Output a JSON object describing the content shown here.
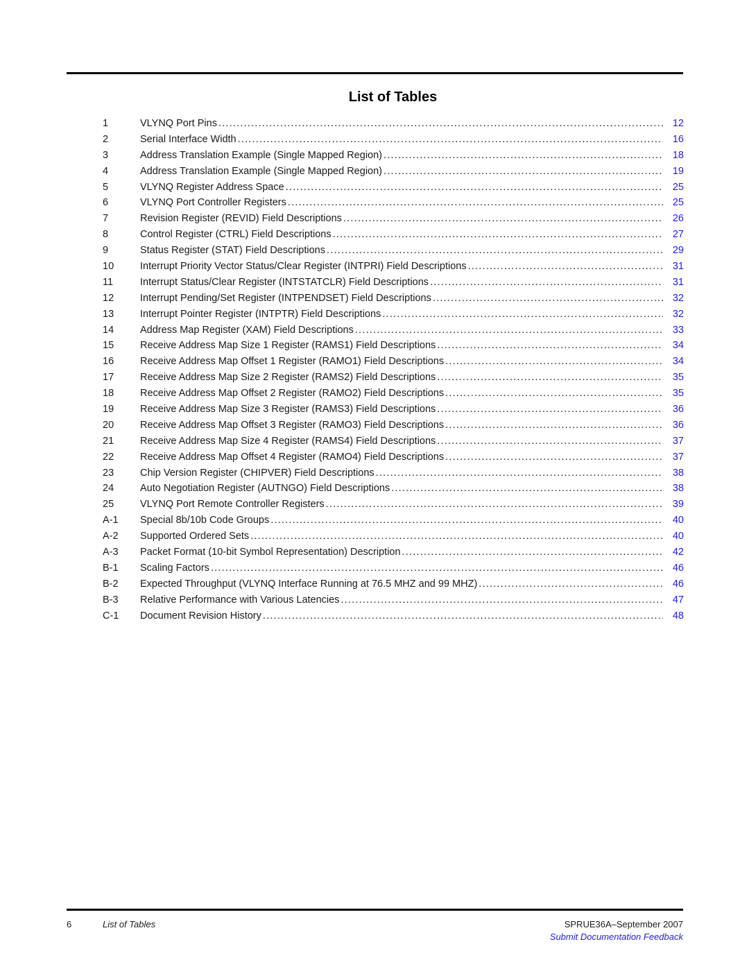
{
  "title": "List of Tables",
  "entries": [
    {
      "num": "1",
      "title": "VLYNQ Port Pins",
      "page": "12"
    },
    {
      "num": "2",
      "title": "Serial Interface Width",
      "page": "16"
    },
    {
      "num": "3",
      "title": "Address Translation Example (Single Mapped Region)",
      "page": "18"
    },
    {
      "num": "4",
      "title": "Address Translation Example (Single Mapped Region)",
      "page": "19"
    },
    {
      "num": "5",
      "title": "VLYNQ Register Address Space",
      "page": "25"
    },
    {
      "num": "6",
      "title": "VLYNQ Port Controller Registers",
      "page": "25"
    },
    {
      "num": "7",
      "title": "Revision Register (REVID) Field Descriptions",
      "page": "26"
    },
    {
      "num": "8",
      "title": "Control Register (CTRL) Field Descriptions",
      "page": "27"
    },
    {
      "num": "9",
      "title": "Status Register (STAT) Field Descriptions",
      "page": "29"
    },
    {
      "num": "10",
      "title": "Interrupt Priority Vector Status/Clear Register (INTPRI) Field Descriptions",
      "page": "31"
    },
    {
      "num": "11",
      "title": "Interrupt Status/Clear Register (INTSTATCLR) Field Descriptions",
      "page": "31"
    },
    {
      "num": "12",
      "title": "Interrupt Pending/Set Register (INTPENDSET) Field Descriptions",
      "page": "32"
    },
    {
      "num": "13",
      "title": "Interrupt Pointer Register (INTPTR) Field Descriptions",
      "page": "32"
    },
    {
      "num": "14",
      "title": "Address Map Register (XAM) Field Descriptions",
      "page": "33"
    },
    {
      "num": "15",
      "title": "Receive Address Map Size 1 Register (RAMS1) Field Descriptions",
      "page": "34"
    },
    {
      "num": "16",
      "title": "Receive Address Map Offset 1 Register (RAMO1) Field Descriptions",
      "page": "34"
    },
    {
      "num": "17",
      "title": "Receive Address Map Size 2 Register (RAMS2) Field Descriptions",
      "page": "35"
    },
    {
      "num": "18",
      "title": "Receive Address Map Offset 2 Register (RAMO2) Field Descriptions",
      "page": "35"
    },
    {
      "num": "19",
      "title": "Receive Address Map Size 3 Register (RAMS3) Field Descriptions",
      "page": "36"
    },
    {
      "num": "20",
      "title": "Receive Address Map Offset 3 Register (RAMO3) Field Descriptions",
      "page": "36"
    },
    {
      "num": "21",
      "title": "Receive Address Map Size 4 Register (RAMS4) Field Descriptions",
      "page": "37"
    },
    {
      "num": "22",
      "title": "Receive Address Map Offset 4 Register (RAMO4) Field Descriptions",
      "page": "37"
    },
    {
      "num": "23",
      "title": "Chip Version Register (CHIPVER) Field Descriptions",
      "page": "38"
    },
    {
      "num": "24",
      "title": "Auto Negotiation Register (AUTNGO) Field Descriptions",
      "page": "38"
    },
    {
      "num": "25",
      "title": "VLYNQ Port Remote Controller Registers",
      "page": "39"
    },
    {
      "num": "A-1",
      "title": "Special 8b/10b Code Groups",
      "page": "40"
    },
    {
      "num": "A-2",
      "title": "Supported Ordered Sets",
      "page": "40"
    },
    {
      "num": "A-3",
      "title": "Packet Format (10-bit Symbol Representation) Description",
      "page": "42"
    },
    {
      "num": "B-1",
      "title": "Scaling Factors",
      "page": "46"
    },
    {
      "num": "B-2",
      "title": "Expected Throughput (VLYNQ Interface Running at 76.5 MHZ and 99 MHZ)",
      "page": "46"
    },
    {
      "num": "B-3",
      "title": "Relative Performance with Various Latencies",
      "page": "47"
    },
    {
      "num": "C-1",
      "title": "Document Revision History",
      "page": "48"
    }
  ],
  "footer": {
    "page_number": "6",
    "section": "List of Tables",
    "doc_id": "SPRUE36A–September 2007",
    "feedback_link": "Submit Documentation Feedback"
  },
  "colors": {
    "link": "#1a1aff",
    "text": "#1a1a1a"
  }
}
